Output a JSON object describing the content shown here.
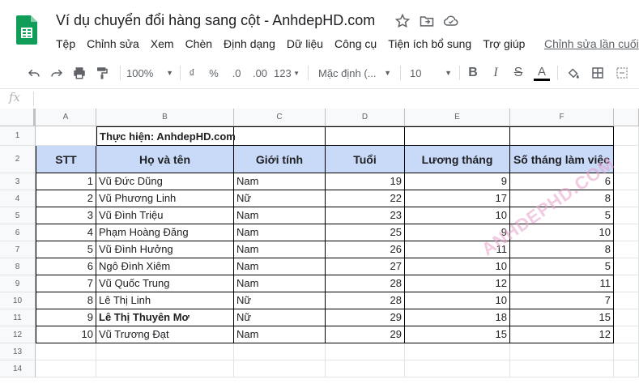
{
  "app": {
    "doc_title": "Ví dụ chuyển đổi hàng sang cột - AnhdepHD.com",
    "menu": [
      "Tệp",
      "Chỉnh sửa",
      "Xem",
      "Chèn",
      "Định dạng",
      "Dữ liệu",
      "Công cụ",
      "Tiện ích bổ sung",
      "Trợ giúp"
    ],
    "last_edit": "Chỉnh sửa lần cuối"
  },
  "toolbar": {
    "zoom": "100%",
    "currency": "₫",
    "percent": "%",
    "dec_decrease": ".0",
    "dec_increase": ".00",
    "more_formats": "123",
    "font": "Mặc định (...",
    "font_size": "10",
    "bold": "B",
    "italic": "I",
    "strike": "S",
    "text_color": "A"
  },
  "formula_bar": {
    "fx": "fx",
    "value": ""
  },
  "sheet": {
    "columns": [
      "A",
      "B",
      "C",
      "D",
      "E",
      "F"
    ],
    "row_numbers": [
      "1",
      "2",
      "3",
      "4",
      "5",
      "6",
      "7",
      "8",
      "9",
      "10",
      "11",
      "12",
      "13",
      "14"
    ],
    "note": "Thực hiện: AnhdepHD.com",
    "headers": [
      "STT",
      "Họ và tên",
      "Giới tính",
      "Tuổi",
      "Lương tháng",
      "Số tháng làm việc"
    ],
    "rows": [
      [
        "1",
        "Vũ Đức Dũng",
        "Nam",
        "19",
        "9",
        "6"
      ],
      [
        "2",
        "Vũ Phương Linh",
        "Nữ",
        "22",
        "17",
        "8"
      ],
      [
        "3",
        "Vũ Đình Triệu",
        "Nam",
        "23",
        "10",
        "5"
      ],
      [
        "4",
        "Phạm Hoàng Đăng",
        "Nam",
        "25",
        "9",
        "10"
      ],
      [
        "5",
        "Vũ Đình Hưởng",
        "Nam",
        "26",
        "11",
        "8"
      ],
      [
        "6",
        "Ngô Đình Xiêm",
        "Nam",
        "27",
        "10",
        "5"
      ],
      [
        "7",
        "Vũ Quốc Trung",
        "Nam",
        "28",
        "12",
        "11"
      ],
      [
        "8",
        "Lê Thị Linh",
        "Nữ",
        "28",
        "10",
        "7"
      ],
      [
        "9",
        "Lê Thị Thuyên Mơ",
        "Nữ",
        "29",
        "18",
        "15"
      ],
      [
        "10",
        "Vũ Trương Đạt",
        "Nam",
        "29",
        "15",
        "12"
      ]
    ],
    "bold_row_index": 8
  },
  "watermark": "ANHDEPHD.COM",
  "colors": {
    "header_fill": "#c9daf8",
    "sheets_green": "#0f9d58"
  }
}
